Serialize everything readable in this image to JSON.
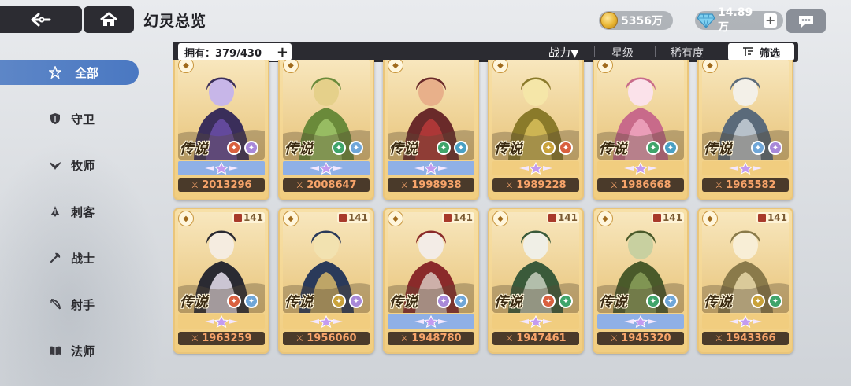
{
  "header": {
    "title": "幻灵总览",
    "gold": "5356万",
    "gems": "14.89万",
    "gems_plus": "+"
  },
  "filter": {
    "owned": "拥有：379/430",
    "owned_plus": "+",
    "sort_power": "战力▼",
    "sort_star": "星级",
    "sort_rarity": "稀有度",
    "filter_label": "筛选"
  },
  "sidebar": {
    "items": [
      {
        "label": "全部",
        "icon": "star-outline-icon"
      },
      {
        "label": "守卫",
        "icon": "shield-icon"
      },
      {
        "label": "牧师",
        "icon": "wing-icon"
      },
      {
        "label": "刺客",
        "icon": "dagger-icon"
      },
      {
        "label": "战士",
        "icon": "axe-icon"
      },
      {
        "label": "射手",
        "icon": "bow-icon"
      },
      {
        "label": "法师",
        "icon": "book-icon"
      }
    ]
  },
  "cards": [
    {
      "tier": "传说",
      "power": "2013296",
      "level": "",
      "elements": [
        "#d9603f",
        "#a888d8"
      ],
      "starbar": "#8fb0e6",
      "art": [
        "#3a2e5a",
        "#6b4ea8",
        "#c7b6e8"
      ]
    },
    {
      "tier": "传说",
      "power": "2008647",
      "level": "",
      "elements": [
        "#3fa46a",
        "#6fa6d8"
      ],
      "starbar": "#8fb0e6",
      "art": [
        "#6a8a3a",
        "#9fc46a",
        "#e5d08a"
      ]
    },
    {
      "tier": "传说",
      "power": "1998938",
      "level": "",
      "elements": [
        "#3fa46a",
        "#4aa0c4"
      ],
      "starbar": "#8fb0e6",
      "art": [
        "#6a2a2a",
        "#b83a3a",
        "#e8b08a"
      ]
    },
    {
      "tier": "传说",
      "power": "1989228",
      "level": "",
      "elements": [
        "#c9a23a",
        "#d9603f"
      ],
      "starbar": "#f1cd7f",
      "art": [
        "#8a7a2a",
        "#d8c05a",
        "#f5e6a8"
      ]
    },
    {
      "tier": "传说",
      "power": "1986668",
      "level": "",
      "elements": [
        "#3fa46a",
        "#4aa0c4"
      ],
      "starbar": "#f1cd7f",
      "art": [
        "#c86a8a",
        "#f0a6c0",
        "#fbe2ea"
      ]
    },
    {
      "tier": "传说",
      "power": "1965582",
      "level": "",
      "elements": [
        "#6fa6d8",
        "#a888d8"
      ],
      "starbar": "#f1cd7f",
      "art": [
        "#5a6a7a",
        "#c8d0d8",
        "#f3f0e8"
      ]
    },
    {
      "tier": "传说",
      "power": "1963259",
      "level": "141",
      "elements": [
        "#d9603f",
        "#6fa6d8"
      ],
      "starbar": "#f1cd7f",
      "art": [
        "#2a2a32",
        "#e8e0f0",
        "#f5ece0"
      ]
    },
    {
      "tier": "传说",
      "power": "1956060",
      "level": "141",
      "elements": [
        "#c9a23a",
        "#a888d8"
      ],
      "starbar": "#f1cd7f",
      "art": [
        "#2a3a5a",
        "#d8b86a",
        "#f2e2b0"
      ]
    },
    {
      "tier": "传说",
      "power": "1948780",
      "level": "141",
      "elements": [
        "#a888d8",
        "#6fa6d8"
      ],
      "starbar": "#8fb0e6",
      "art": [
        "#8a2a2a",
        "#d8c8c0",
        "#f3ece6"
      ]
    },
    {
      "tier": "传说",
      "power": "1947461",
      "level": "141",
      "elements": [
        "#d9603f",
        "#3fa46a"
      ],
      "starbar": "#f1cd7f",
      "art": [
        "#3a5a3a",
        "#c8d0c0",
        "#f0efe6"
      ]
    },
    {
      "tier": "传说",
      "power": "1945320",
      "level": "141",
      "elements": [
        "#3fa46a",
        "#6fa6d8"
      ],
      "starbar": "#8fb0e6",
      "art": [
        "#4a5a2a",
        "#8aa05a",
        "#c8d0a0"
      ]
    },
    {
      "tier": "传说",
      "power": "1943366",
      "level": "141",
      "elements": [
        "#c9a23a",
        "#3fa46a"
      ],
      "starbar": "#f1cd7f",
      "art": [
        "#8a7a4a",
        "#e8d8a8",
        "#f8eed6"
      ]
    }
  ]
}
